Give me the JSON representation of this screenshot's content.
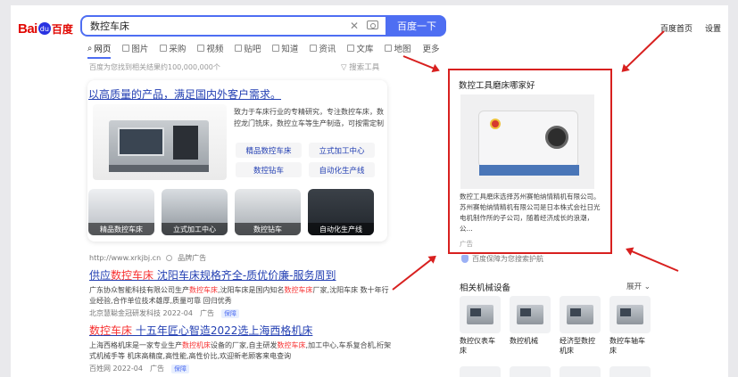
{
  "header": {
    "logo_text_1": "Bai",
    "logo_paw": "du",
    "logo_text_2": "百度",
    "search_value": "数控车床",
    "search_button": "百度一下",
    "links": [
      "百度首页",
      "设置"
    ]
  },
  "tabs": [
    {
      "label": "网页",
      "active": true
    },
    {
      "label": "图片"
    },
    {
      "label": "采购"
    },
    {
      "label": "视频"
    },
    {
      "label": "贴吧"
    },
    {
      "label": "知道"
    },
    {
      "label": "资讯"
    },
    {
      "label": "文库"
    },
    {
      "label": "地图"
    },
    {
      "label": "更多"
    }
  ],
  "result_count": "百度为您找到相关结果约100,000,000个",
  "search_tools": "搜索工具",
  "ad": {
    "title": "以高质量的产品，满足国内外客户需求。",
    "description": "致力于车床行业的专精研究，专注数控车床，数控龙门铣床，数控立车等生产制造，可按需定制",
    "links": [
      "精品数控车床",
      "立式加工中心",
      "数控钻车",
      "自动化生产线"
    ],
    "thumbs": [
      "精品数控车床",
      "立式加工中心",
      "数控钻车",
      "自动化生产线"
    ],
    "url": "http://www.xrkjbj.cn",
    "label": "品牌广告"
  },
  "results": [
    {
      "title_pre": "供应",
      "title_em": "数控车床",
      "title_post": " 沈阳车床规格齐全-质优价廉-服务周到",
      "desc_1": "广东协众智能科技有限公司生产",
      "desc_em_1": "数控车床",
      "desc_2": ",沈阳车床是国内知名",
      "desc_em_2": "数控车床",
      "desc_3": "厂家,沈阳车床 数十年行业经验,合作单位技术雄厚,质量可靠 回归优秀",
      "source": "北京慧聪金冠研发科技 2022-04",
      "ad_label": "广告",
      "badge": "保障"
    },
    {
      "title_pre": "",
      "title_em": "数控车床",
      "title_post": " 十五年匠心智造2022选上海西格机床",
      "desc_1": "上海西格机床是一家专业生产",
      "desc_em_1": "数控机床",
      "desc_2": "设备的厂家,自主研发",
      "desc_em_2": "数控车床",
      "desc_3": ",加工中心,车系复合机,桁架式机械手等 机床高精度,高性能,高性价比,欢迎新老顾客来电查询",
      "source": "百姓网 2022-04",
      "ad_label": "广告",
      "badge": "保障"
    }
  ],
  "right_panel": {
    "title": "数控工具磨床哪家好",
    "description": "数控工具磨床选择苏州赛帕纳情精机有限公司。苏州赛帕纳情精机有限公司是日本株式会社日光电机制作所的子公司，随着经济成长的浪潮，公...",
    "ad_label": "广告",
    "protect": "百度保障为您搜索护航"
  },
  "related": {
    "title": "相关机械设备",
    "expand": "展开",
    "items": [
      "数控仪表车床",
      "数控机械",
      "经济型数控机床",
      "数控车轴车床"
    ]
  },
  "colors": {
    "brand_blue": "#4e6ef2",
    "link_blue": "#2440b3",
    "highlight_red": "#f73131",
    "annotation_red": "#d8201f"
  }
}
